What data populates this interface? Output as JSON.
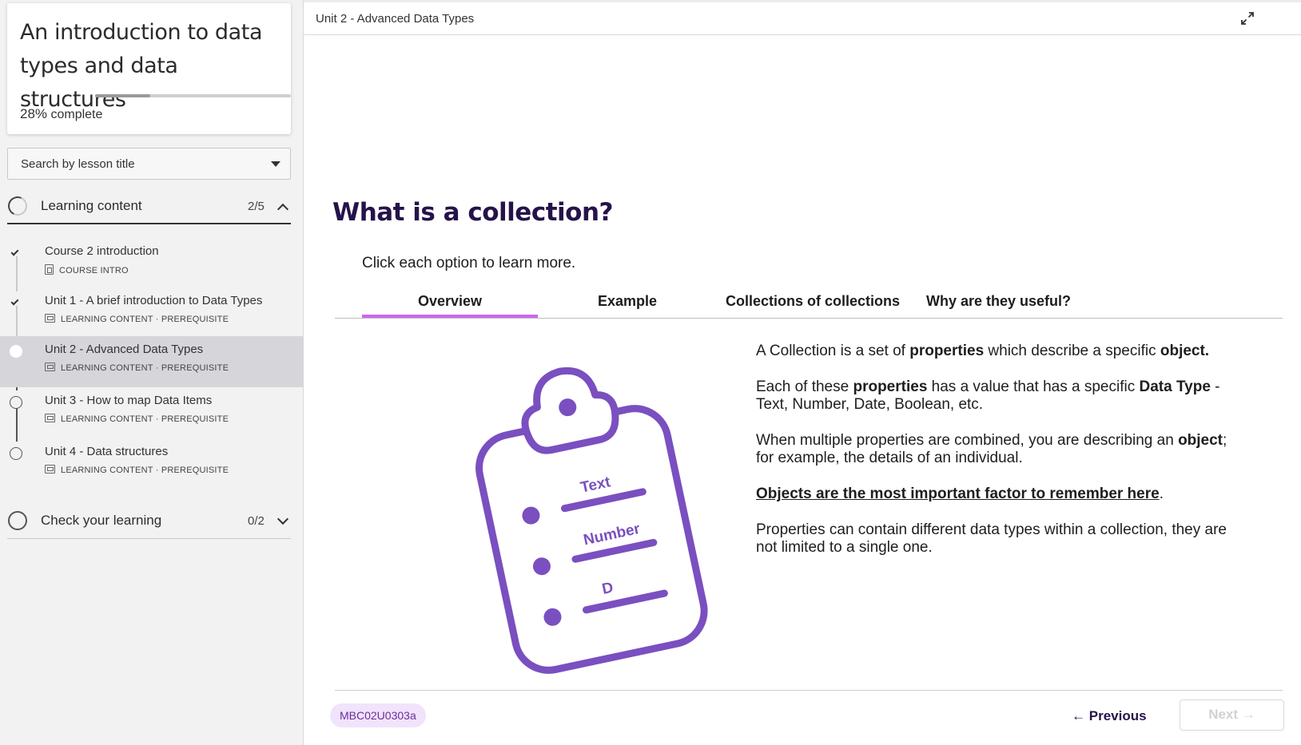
{
  "sidebar": {
    "course_title": "An introduction to data types and data structures",
    "progress_percent": 28,
    "progress_value": "28%",
    "progress_suffix": " complete",
    "search_placeholder": "Search by lesson title",
    "sections": [
      {
        "label": "Learning content",
        "count": "2/5",
        "expanded": true,
        "lessons": [
          {
            "title": "Course 2 introduction",
            "meta": "COURSE INTRO",
            "status": "done"
          },
          {
            "title": "Unit 1 - A brief introduction to Data Types",
            "meta": "LEARNING CONTENT · PREREQUISITE",
            "status": "done"
          },
          {
            "title": "Unit 2 - Advanced Data Types",
            "meta": "LEARNING CONTENT · PREREQUISITE",
            "status": "current"
          },
          {
            "title": "Unit 3 - How to map Data Items",
            "meta": "LEARNING CONTENT · PREREQUISITE",
            "status": "not-started"
          },
          {
            "title": "Unit 4 - Data structures",
            "meta": "LEARNING CONTENT · PREREQUISITE",
            "status": "not-started"
          }
        ]
      },
      {
        "label": "Check your learning",
        "count": "0/2",
        "expanded": false
      }
    ]
  },
  "header": {
    "breadcrumb": "Unit 2 - Advanced Data Types",
    "expand_icon": "expand-icon"
  },
  "content": {
    "title": "What is a collection?",
    "instruction": "Click each option to learn more.",
    "tabs": [
      {
        "label": "Overview",
        "selected": true
      },
      {
        "label": "Example",
        "selected": false
      },
      {
        "label": "Collections of collections",
        "selected": false
      },
      {
        "label": "Why are they useful?",
        "selected": false
      }
    ],
    "illustration": {
      "icon": "clipboard-checklist-icon",
      "labels": [
        "Text",
        "Number",
        "D"
      ]
    },
    "paragraphs": {
      "p1": {
        "a": "A Collection is a set of ",
        "b1": "properties",
        "c": " which describe a specific ",
        "b2": "object."
      },
      "p2": {
        "a": "Each of these ",
        "b1": "properties",
        "c": " has a value that has a specific ",
        "b2": "Data Type",
        "d": " - Text, Number, Date, Boolean, etc."
      },
      "p3": {
        "a": "When multiple properties are combined, you are describing an ",
        "b1": "object",
        "c": "; for example, the details of an individual."
      },
      "p4": {
        "link": "Objects are the most important factor to remember here",
        "end": "."
      },
      "p5": "Properties can contain different data types within a collection, they are not limited to a single one."
    }
  },
  "footer": {
    "code": "MBC02U0303a",
    "previous_label": "Previous",
    "next_label": "Next"
  },
  "colors": {
    "accent_purple": "#c868f0",
    "illustration_purple": "#7a4fc0",
    "heading": "#25134a"
  }
}
